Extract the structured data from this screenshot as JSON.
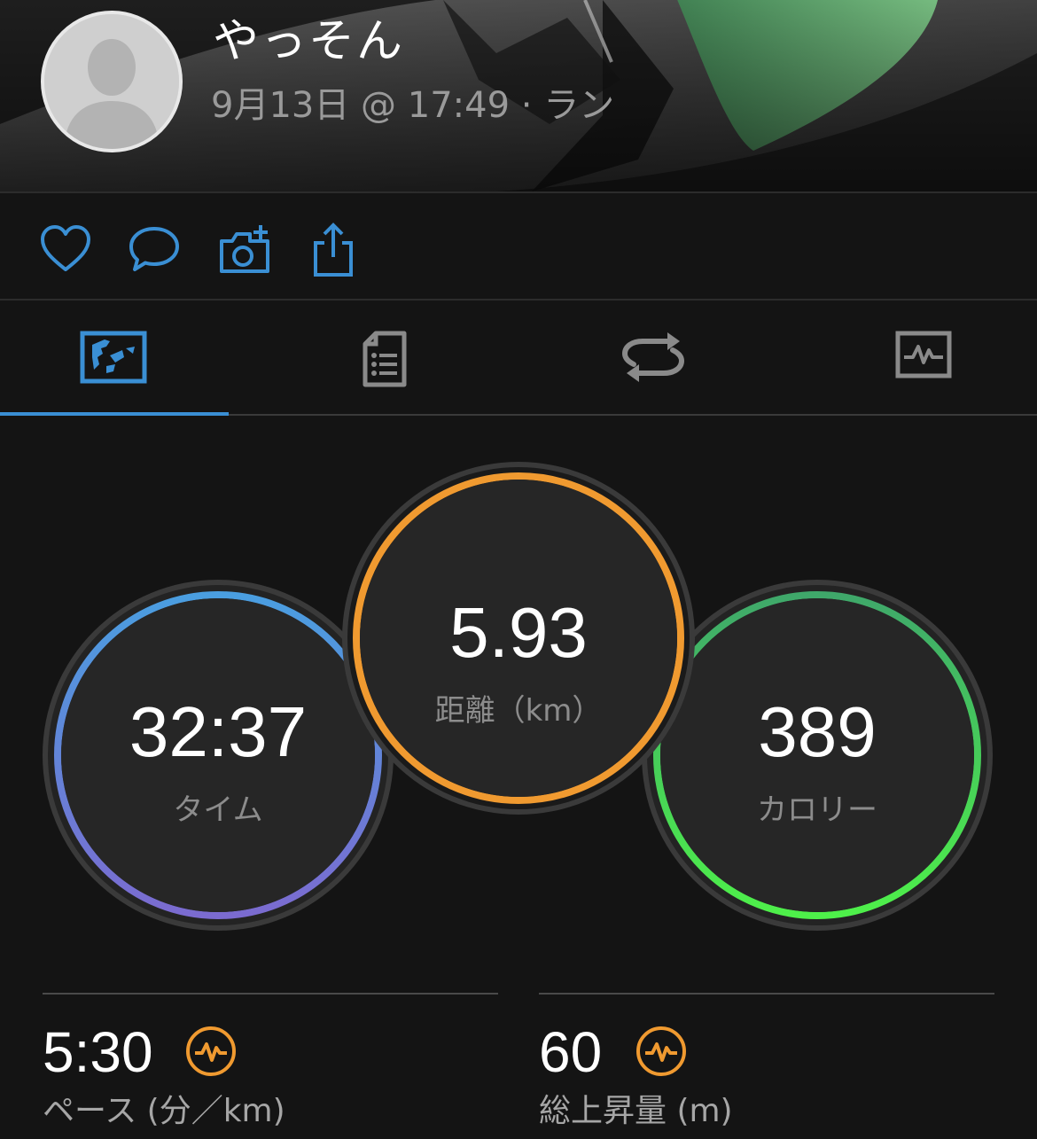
{
  "header": {
    "user_name": "やっそん",
    "activity_meta": "9月13日 @ 17:49 · ラン"
  },
  "actions": {
    "icons": [
      "heart-icon",
      "comment-icon",
      "add-photo-icon",
      "share-icon"
    ],
    "accent": "#3a8fd4"
  },
  "tabs": {
    "items": [
      "summary-tab",
      "details-tab",
      "laps-tab",
      "charts-tab"
    ],
    "active_index": 0
  },
  "stats": {
    "time": {
      "value": "32:37",
      "label": "タイム"
    },
    "distance": {
      "value": "5.93",
      "label": "距離（km）"
    },
    "calories": {
      "value": "389",
      "label": "カロリー"
    }
  },
  "metrics": {
    "pace": {
      "value": "5:30",
      "label": "ペース (分／km)",
      "icon": "activity-badge-icon"
    },
    "ascent": {
      "value": "60",
      "label": "総上昇量 (m)",
      "icon": "activity-badge-icon"
    }
  },
  "colors": {
    "time_ring_top": "#4a9ee0",
    "time_ring_bottom": "#7b6bd0",
    "distance_ring": "#f09a30",
    "calories_ring_top": "#3fa86a",
    "calories_ring_bottom": "#4ef04a",
    "metric_icon": "#f09a30"
  }
}
